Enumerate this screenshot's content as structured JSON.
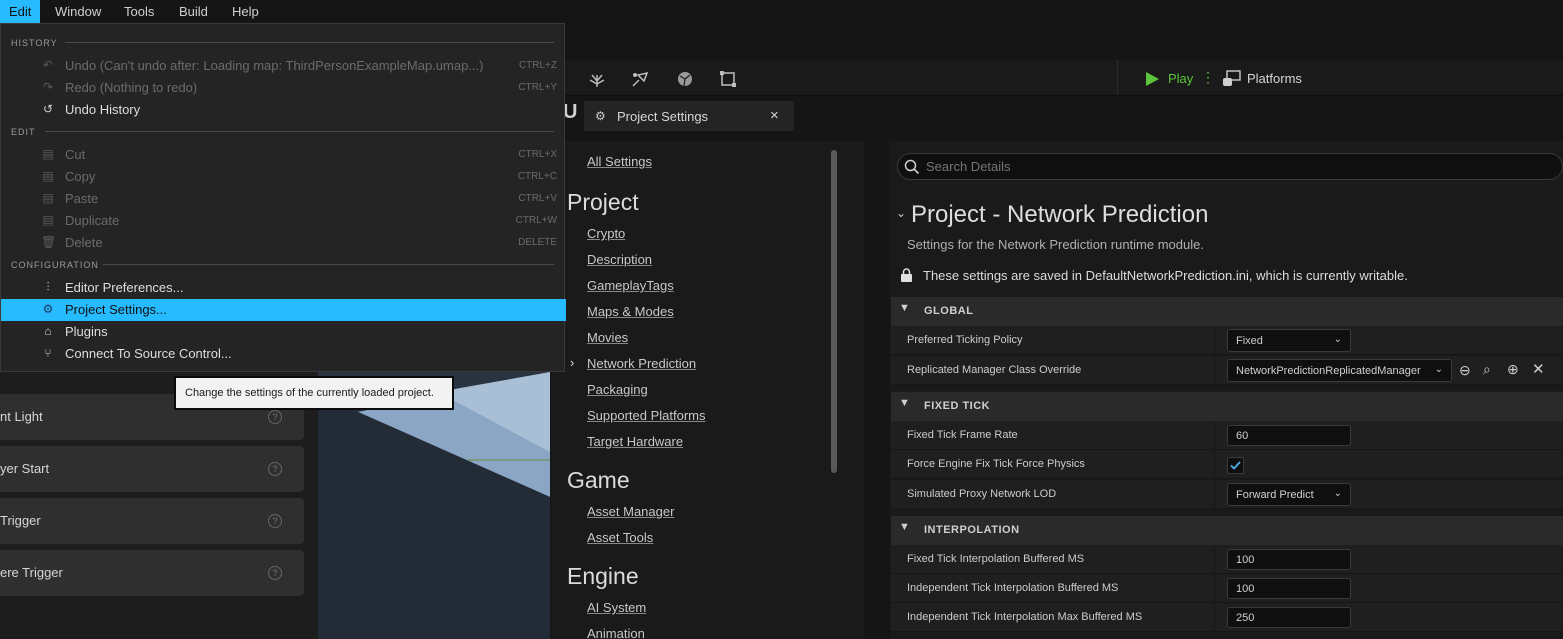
{
  "menubar": {
    "items": [
      "Edit",
      "Window",
      "Tools",
      "Build",
      "Help"
    ]
  },
  "toolbar": {
    "play_label": "Play",
    "platforms_label": "Platforms",
    "icons": [
      "foliage-icon",
      "paint-icon",
      "fracture-icon",
      "modeling-icon"
    ]
  },
  "edit_menu": {
    "sections": {
      "history": "HISTORY",
      "edit": "EDIT",
      "configuration": "CONFIGURATION"
    },
    "items": [
      {
        "label": "Undo (Can't undo after: Loading map: ThirdPersonExampleMap.umap...)",
        "shortcut": "CTRL+Z",
        "icon": "undo-icon"
      },
      {
        "label": "Redo (Nothing to redo)",
        "shortcut": "CTRL+Y",
        "icon": "redo-icon"
      },
      {
        "label": "Undo History",
        "shortcut": "",
        "icon": "history-icon"
      },
      {
        "label": "Cut",
        "shortcut": "CTRL+X",
        "icon": "cut-icon"
      },
      {
        "label": "Copy",
        "shortcut": "CTRL+C",
        "icon": "copy-icon"
      },
      {
        "label": "Paste",
        "shortcut": "CTRL+V",
        "icon": "paste-icon"
      },
      {
        "label": "Duplicate",
        "shortcut": "CTRL+W",
        "icon": "duplicate-icon"
      },
      {
        "label": "Delete",
        "shortcut": "DELETE",
        "icon": "delete-icon"
      },
      {
        "label": "Editor Preferences...",
        "shortcut": "",
        "icon": "sliders-icon"
      },
      {
        "label": "Project Settings...",
        "shortcut": "",
        "icon": "gear-icon"
      },
      {
        "label": "Plugins",
        "shortcut": "",
        "icon": "plug-icon"
      },
      {
        "label": "Connect To Source Control...",
        "shortcut": "",
        "icon": "source-control-icon"
      }
    ]
  },
  "tooltip": "Change the settings of the currently loaded project.",
  "place_panel": {
    "items": [
      "nt Light",
      "yer Start",
      " Trigger",
      "ere Trigger"
    ]
  },
  "settings_window": {
    "tab_title": "Project Settings",
    "close": "×",
    "nav": {
      "all_settings": "All Settings",
      "project_heading": "Project",
      "project_links": [
        "Crypto",
        "Description",
        "GameplayTags",
        "Maps & Modes",
        "Movies",
        "Network Prediction",
        "Packaging",
        "Supported Platforms",
        "Target Hardware"
      ],
      "game_heading": "Game",
      "game_links": [
        "Asset Manager",
        "Asset Tools"
      ],
      "engine_heading": "Engine",
      "engine_links": [
        "AI System",
        "Animation"
      ]
    },
    "details": {
      "search_placeholder": "Search Details",
      "title": "Project - Network Prediction",
      "subtitle": "Settings for the Network Prediction runtime module.",
      "saved_note": "These settings are saved in DefaultNetworkPrediction.ini, which is currently writable.",
      "categories": {
        "global": "GLOBAL",
        "fixed_tick": "FIXED TICK",
        "interpolation": "INTERPOLATION"
      },
      "props": {
        "preferred_ticking_policy": {
          "label": "Preferred Ticking Policy",
          "value": "Fixed"
        },
        "replicated_manager": {
          "label": "Replicated Manager Class Override",
          "value": "NetworkPredictionReplicatedManager"
        },
        "fixed_tick_frame_rate": {
          "label": "Fixed Tick Frame Rate",
          "value": "60"
        },
        "force_engine_fix_tick": {
          "label": "Force Engine Fix Tick Force Physics",
          "checked": true
        },
        "simulated_proxy_lod": {
          "label": "Simulated Proxy Network LOD",
          "value": "Forward Predict"
        },
        "fixed_tick_interp": {
          "label": "Fixed Tick Interpolation Buffered MS",
          "value": "100"
        },
        "independent_tick_interp": {
          "label": "Independent Tick Interpolation Buffered MS",
          "value": "100"
        },
        "independent_tick_interp_max": {
          "label": "Independent Tick Interpolation Max Buffered MS",
          "value": "250"
        }
      }
    }
  },
  "colors": {
    "accent": "#26bbff",
    "play_green": "#5bc43a"
  }
}
